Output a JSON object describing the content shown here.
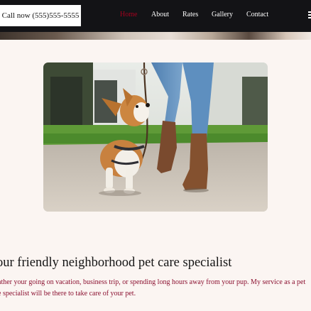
{
  "header": {
    "call_label": "Call now (555)555-5555",
    "nav": [
      {
        "label": "Home",
        "active": true
      },
      {
        "label": "About",
        "active": false
      },
      {
        "label": "Rates",
        "active": false
      },
      {
        "label": "Gallery",
        "active": false
      },
      {
        "label": "Contact",
        "active": false
      }
    ],
    "menu_icon": "hamburger-menu-icon"
  },
  "main": {
    "photo": "corgi-puppy-on-leash-walking-with-owner",
    "headline": "our friendly neighborhood pet care specialist",
    "intro_lines": [
      "ather your going on vacation, business trip, or spending long hours away from your pup. My service as a pet",
      "e specialist will be there to take care of your pet."
    ]
  },
  "colors": {
    "nav_background": "#131316",
    "page_background": "#fbf5f2",
    "active_link": "#a3001e",
    "intro_text": "#8b1030"
  }
}
